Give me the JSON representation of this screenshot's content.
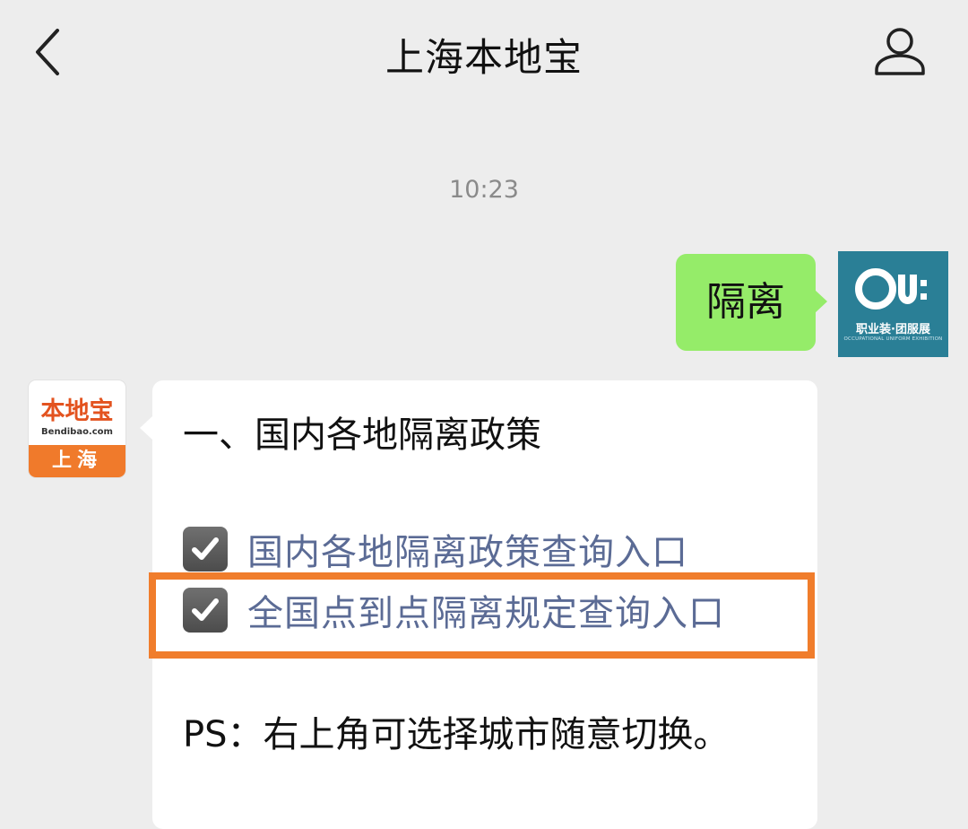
{
  "header": {
    "title": "上海本地宝",
    "back_icon": "chevron-left-icon",
    "profile_icon": "person-icon"
  },
  "time": "10:23",
  "outgoing": {
    "text": "隔离",
    "bubble_color": "#95ec69",
    "avatar": {
      "logo": "Ou",
      "name": "职业装·团服展",
      "sub": "OCCUPATIONAL UNIFORM EXHIBITION",
      "bg": "#2a7f96"
    }
  },
  "incoming": {
    "avatar": {
      "name": "本地宝",
      "domain": "Bendibao.com",
      "city": "上海",
      "accent": "#f07a2b"
    },
    "heading": "一、国内各地隔离政策",
    "links": [
      {
        "text": "国内各地隔离政策查询入口",
        "icon": "checkbox-checked-icon"
      },
      {
        "text": "全国点到点隔离规定查询入口",
        "icon": "checkbox-checked-icon",
        "highlighted": true
      }
    ],
    "note": "PS：右上角可选择城市随意切换。"
  },
  "colors": {
    "link": "#5b6b95",
    "highlight": "#f07d2c",
    "background": "#ededed"
  }
}
